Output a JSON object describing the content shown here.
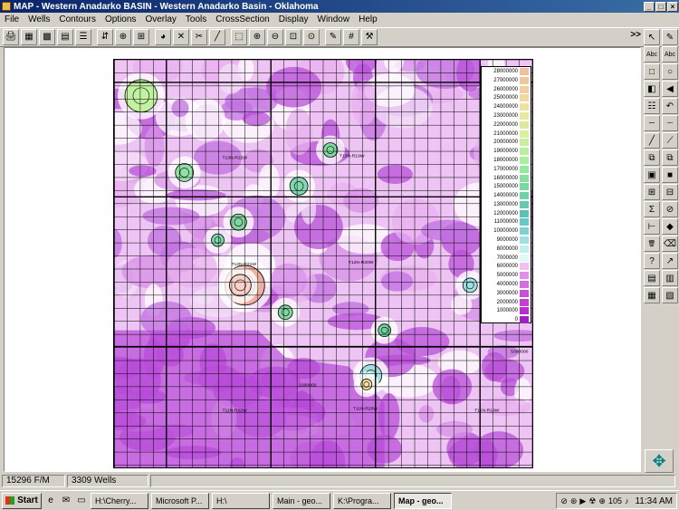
{
  "window": {
    "title": "MAP - Western Anadarko BASIN - Western Anadarko Basin - Oklahoma",
    "minimize": "_",
    "maximize": "□",
    "close": "×"
  },
  "menu": [
    "File",
    "Wells",
    "Contours",
    "Options",
    "Overlay",
    "Tools",
    "CrossSection",
    "Display",
    "Window",
    "Help"
  ],
  "toolbar": {
    "buttons": [
      {
        "name": "print-icon",
        "glyph": "🖨"
      },
      {
        "name": "contour-map-icon",
        "glyph": "▦"
      },
      {
        "name": "color-grid-icon",
        "glyph": "▩"
      },
      {
        "name": "grid-map-icon",
        "glyph": "▤"
      },
      {
        "name": "well-list-icon",
        "glyph": "☰"
      },
      {
        "name": "posting-icon",
        "glyph": "⇵"
      },
      {
        "name": "well-symbol-icon",
        "glyph": "⊕"
      },
      {
        "name": "section-icon",
        "glyph": "⊞"
      },
      {
        "name": "pie-icon",
        "glyph": "◕"
      },
      {
        "name": "cross-icon",
        "glyph": "✕"
      },
      {
        "name": "measure-icon",
        "glyph": "✂"
      },
      {
        "name": "line-icon",
        "glyph": "╱"
      },
      {
        "name": "select-box-icon",
        "glyph": "⬚"
      },
      {
        "name": "zoom-in-icon",
        "glyph": "⊕"
      },
      {
        "name": "zoom-out-icon",
        "glyph": "⊖"
      },
      {
        "name": "zoom-window-icon",
        "glyph": "⊡"
      },
      {
        "name": "zoom-extent-icon",
        "glyph": "⊙"
      },
      {
        "name": "pencil-icon",
        "glyph": "✎"
      },
      {
        "name": "grid-toggle-icon",
        "glyph": "#"
      },
      {
        "name": "tools-icon",
        "glyph": "⚒"
      }
    ],
    "more": ">>"
  },
  "legend": {
    "labels": [
      "28000000",
      "27000000",
      "26000000",
      "25000000",
      "24000000",
      "23000000",
      "22000000",
      "21000000",
      "20000000",
      "19000000",
      "18000000",
      "17000000",
      "16000000",
      "15000000",
      "14000000",
      "13000000",
      "12000000",
      "11000000",
      "10000000",
      "9000000",
      "8000000",
      "7000000",
      "6000000",
      "5000000",
      "4000000",
      "3000000",
      "2000000",
      "1000000",
      "0"
    ],
    "colors": [
      "#f0c0a0",
      "#f0c8a0",
      "#f0d0a0",
      "#f0d8a0",
      "#f0e0a0",
      "#e8e8a0",
      "#e0e8a0",
      "#d8f0a0",
      "#c8f0a0",
      "#b8f0a0",
      "#a8f0a0",
      "#98e8a0",
      "#88e0a0",
      "#78d8a0",
      "#70d0a8",
      "#68c8b0",
      "#60c0b8",
      "#68c8c8",
      "#80d0d0",
      "#a0e0e0",
      "#c0f0f0",
      "#e0f8f8",
      "#f0c0f0",
      "#e090e8",
      "#d070e0",
      "#c850d8",
      "#c040d0",
      "#b830c8",
      "#a020c0"
    ]
  },
  "map_labels": [
    "T13N-R22W",
    "T13N-R19W",
    "T12N-R21W",
    "T12N-R20W",
    "T11N-R22W",
    "T11N-R20W",
    "T11N-R19W",
    "1000000",
    "5000000"
  ],
  "vtools": [
    {
      "name": "select-arrow-icon",
      "glyph": "↖"
    },
    {
      "name": "pen-icon",
      "glyph": "✎"
    },
    {
      "name": "text-icon",
      "glyph": "Abc"
    },
    {
      "name": "text-box-icon",
      "glyph": "Abc"
    },
    {
      "name": "rectangle-icon",
      "glyph": "□"
    },
    {
      "name": "circle-icon",
      "glyph": "○"
    },
    {
      "name": "fill-icon",
      "glyph": "◧"
    },
    {
      "name": "arrow-icon",
      "glyph": "◀"
    },
    {
      "name": "list-icon",
      "glyph": "☷"
    },
    {
      "name": "undo-icon",
      "glyph": "↶"
    },
    {
      "name": "dash-line-icon",
      "glyph": "┄"
    },
    {
      "name": "dotted-line-icon",
      "glyph": "┈"
    },
    {
      "name": "line-tool-icon",
      "glyph": "╱"
    },
    {
      "name": "polyline-icon",
      "glyph": "⟋"
    },
    {
      "name": "copy-icon",
      "glyph": "⧉"
    },
    {
      "name": "paste-icon",
      "glyph": "⧉"
    },
    {
      "name": "box-red-icon",
      "glyph": "▣"
    },
    {
      "name": "box-fill-icon",
      "glyph": "■"
    },
    {
      "name": "group-icon",
      "glyph": "⊞"
    },
    {
      "name": "ungroup-icon",
      "glyph": "⊟"
    },
    {
      "name": "sigma-icon",
      "glyph": "Σ"
    },
    {
      "name": "no-icon",
      "glyph": "⊘"
    },
    {
      "name": "ruler-icon",
      "glyph": "⊢"
    },
    {
      "name": "shape-icon",
      "glyph": "◆"
    },
    {
      "name": "delete-icon",
      "glyph": "🗑"
    },
    {
      "name": "erase-icon",
      "glyph": "⌫"
    },
    {
      "name": "help-icon",
      "glyph": "?"
    },
    {
      "name": "pointer-help-icon",
      "glyph": "↗"
    },
    {
      "name": "layer-icon",
      "glyph": "▤"
    },
    {
      "name": "layer-add-icon",
      "glyph": "▥"
    },
    {
      "name": "save-layer-icon",
      "glyph": "▦"
    },
    {
      "name": "load-layer-icon",
      "glyph": "▧"
    }
  ],
  "status": {
    "field1": "15296 F/M",
    "field2": "3309 Wells"
  },
  "taskbar": {
    "start": "Start",
    "quicklaunch": [
      "ie-icon",
      "outlook-icon",
      "desktop-icon"
    ],
    "tasks": [
      {
        "label": "H:\\Cherry...",
        "active": false
      },
      {
        "label": "Microsoft P...",
        "active": false
      },
      {
        "label": "H:\\",
        "active": false
      },
      {
        "label": "Main - geo...",
        "active": false
      },
      {
        "label": "K:\\Progra...",
        "active": false
      },
      {
        "label": "Map - geo...",
        "active": true
      }
    ],
    "tray_count": "105",
    "clock": "11:34 AM"
  }
}
